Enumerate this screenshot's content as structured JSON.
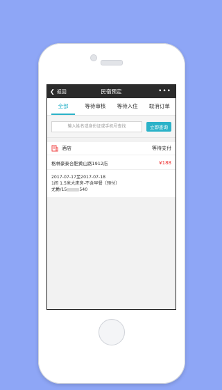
{
  "nav": {
    "back_label": "返回",
    "title": "民宿预定",
    "more_label": "•••"
  },
  "tabs": [
    {
      "label": "全部",
      "active": true
    },
    {
      "label": "等待审核",
      "active": false
    },
    {
      "label": "等待入住",
      "active": false
    },
    {
      "label": "取消订单",
      "active": false
    }
  ],
  "search": {
    "placeholder": "输入姓名或身份证或手机号查找",
    "button_label": "立即查询"
  },
  "order": {
    "category": "酒店",
    "status": "等待支付",
    "hotel_name": "格林豪泰合肥黄山路1912店",
    "price": "¥188",
    "dates": "2017-07-17至2017-07-18",
    "room": "1间 1.5米大床房-不含早餐（预付）",
    "guest_prefix": "尤爵/15",
    "guest_suffix": "540"
  },
  "colors": {
    "accent": "#2bb2c8",
    "price": "#ee3333",
    "nav_bg": "#2b2b2b",
    "background": "#8ea6f6"
  }
}
